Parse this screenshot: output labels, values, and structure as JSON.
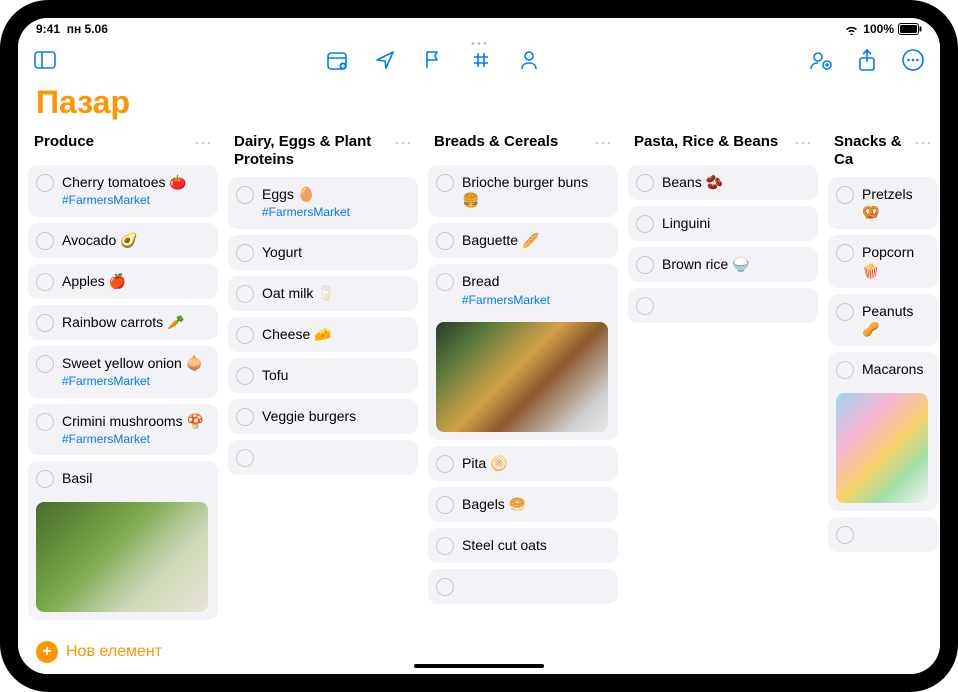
{
  "status": {
    "time": "9:41",
    "date": "пн 5.06",
    "battery": "100%"
  },
  "title": "Пазар",
  "columns": [
    {
      "title": "Produce",
      "items": [
        {
          "label": "Cherry tomatoes 🍅",
          "tag": "#FarmersMarket"
        },
        {
          "label": "Avocado 🥑"
        },
        {
          "label": "Apples 🍎"
        },
        {
          "label": "Rainbow carrots 🥕"
        },
        {
          "label": "Sweet yellow onion 🧅",
          "tag": "#FarmersMarket"
        },
        {
          "label": "Crimini mushrooms 🍄",
          "tag": "#FarmersMarket"
        },
        {
          "label": "Basil",
          "image": "basil"
        }
      ]
    },
    {
      "title": "Dairy, Eggs & Plant Proteins",
      "items": [
        {
          "label": "Eggs 🥚",
          "tag": "#FarmersMarket"
        },
        {
          "label": "Yogurt"
        },
        {
          "label": "Oat milk 🥛"
        },
        {
          "label": "Cheese 🧀"
        },
        {
          "label": "Tofu"
        },
        {
          "label": "Veggie burgers"
        },
        {
          "label": "",
          "empty": true
        }
      ]
    },
    {
      "title": "Breads & Cereals",
      "items": [
        {
          "label": "Brioche burger buns 🍔"
        },
        {
          "label": "Baguette 🥖"
        },
        {
          "label": "Bread",
          "tag": "#FarmersMarket",
          "image": "bread"
        },
        {
          "label": "Pita 🫓"
        },
        {
          "label": "Bagels 🥯"
        },
        {
          "label": "Steel cut oats"
        },
        {
          "label": "",
          "empty": true
        }
      ]
    },
    {
      "title": "Pasta, Rice & Beans",
      "items": [
        {
          "label": "Beans 🫘"
        },
        {
          "label": "Linguini"
        },
        {
          "label": "Brown rice 🍚"
        },
        {
          "label": "",
          "empty": true
        }
      ]
    },
    {
      "title": "Snacks & Ca",
      "partial": true,
      "items": [
        {
          "label": "Pretzels 🥨"
        },
        {
          "label": "Popcorn 🍿"
        },
        {
          "label": "Peanuts 🥜"
        },
        {
          "label": "Macarons",
          "image": "macarons"
        },
        {
          "label": "",
          "empty": true
        }
      ]
    }
  ],
  "bottom": {
    "add_label": "Нов елемент"
  }
}
